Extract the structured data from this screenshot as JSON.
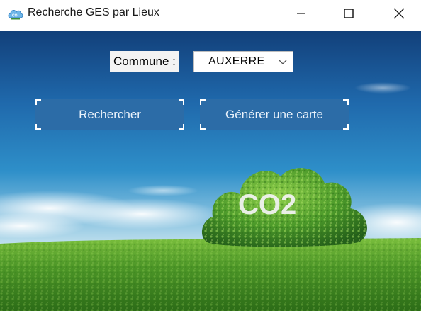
{
  "window": {
    "title": "Recherche GES par Lieux",
    "app_icon": "co2-cloud-icon",
    "controls": [
      "minimize-icon",
      "maximize-icon",
      "close-icon"
    ]
  },
  "form": {
    "commune_label": "Commune :",
    "commune_value": "AUXERRE",
    "search_button": "Rechercher",
    "map_button": "Générer une carte"
  },
  "background": {
    "subject": "co2-cloud-shaped-hedge-on-grass",
    "cloud_text": "CO2"
  },
  "colors": {
    "sky_top": "#12407a",
    "sky_mid": "#2a86c4",
    "horizon": "#bfe0ee",
    "grass": "#4f9a2a",
    "button": "#2c6ca7",
    "button_text": "#eaf2fb"
  }
}
